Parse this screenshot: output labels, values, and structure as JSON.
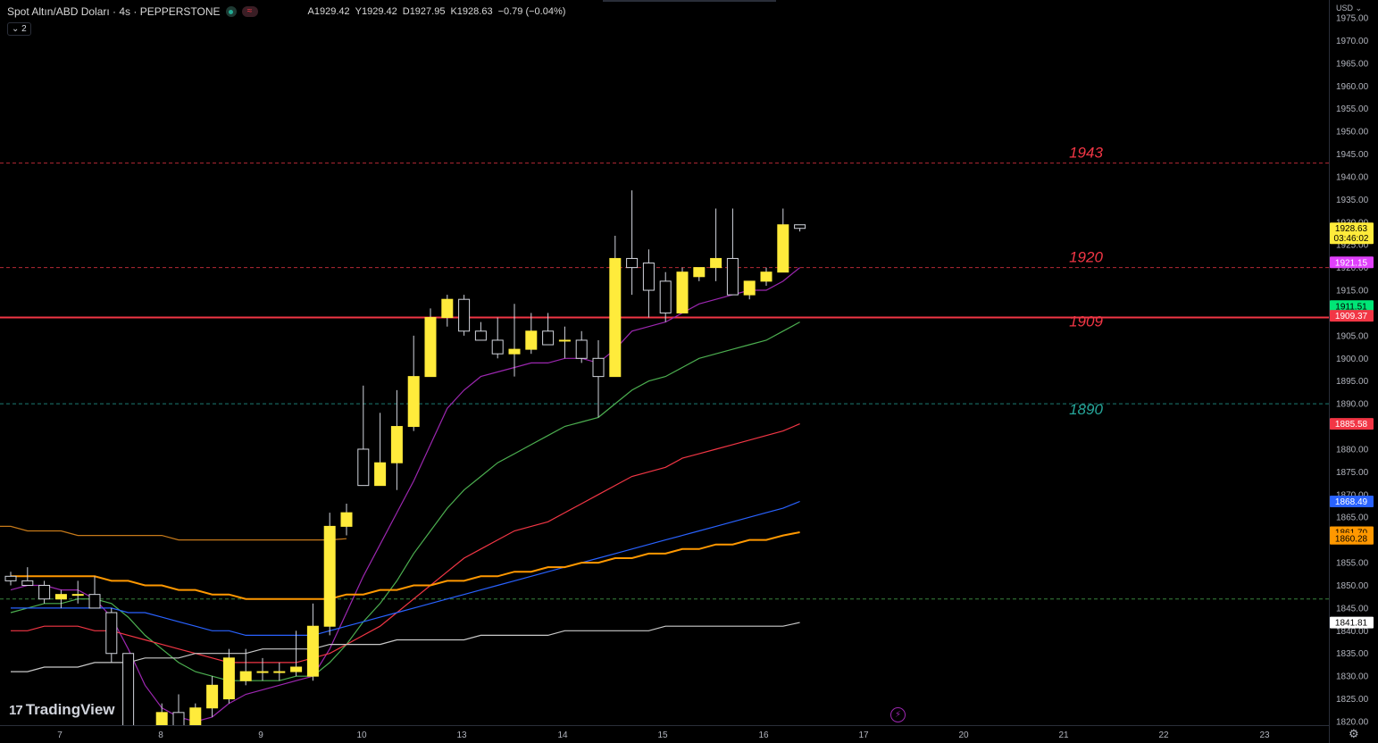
{
  "header": {
    "symbol": "Spot Altın/ABD Doları · 4s · PEPPERSTONE",
    "open": "A1929.42",
    "high": "Y1929.42",
    "low": "D1927.95",
    "close": "K1928.63",
    "change": "−0.79 (−0.04%)",
    "indicator_badge": "⌄ 2",
    "currency": "USD ⌄"
  },
  "branding": {
    "logo_mark": "17",
    "logo_text": "TradingView"
  },
  "colors": {
    "up": "#ffeb3b",
    "down": "#000000",
    "wick": "#d1d4dc",
    "grid": "#1b1e24",
    "background": "#000000"
  },
  "chart_data": {
    "type": "candlestick",
    "ylim": [
      1820,
      1975
    ],
    "y_ticks": [
      1820,
      1825,
      1830,
      1835,
      1840,
      1845,
      1850,
      1855,
      1860,
      1865,
      1870,
      1875,
      1880,
      1885,
      1890,
      1895,
      1900,
      1905,
      1910,
      1915,
      1920,
      1925,
      1930,
      1935,
      1940,
      1945,
      1950,
      1955,
      1960,
      1965,
      1970,
      1975
    ],
    "x_ticks": [
      "7",
      "8",
      "9",
      "10",
      "13",
      "14",
      "15",
      "16",
      "17",
      "20",
      "21",
      "22",
      "23"
    ],
    "candles": [
      {
        "o": 1852,
        "h": 1853,
        "l": 1850,
        "c": 1851
      },
      {
        "o": 1851,
        "h": 1854,
        "l": 1850,
        "c": 1850
      },
      {
        "o": 1850,
        "h": 1851,
        "l": 1846,
        "c": 1847
      },
      {
        "o": 1847,
        "h": 1849,
        "l": 1845,
        "c": 1848
      },
      {
        "o": 1848,
        "h": 1851,
        "l": 1846,
        "c": 1848
      },
      {
        "o": 1848,
        "h": 1852,
        "l": 1845,
        "c": 1845
      },
      {
        "o": 1844,
        "h": 1845,
        "l": 1833,
        "c": 1835
      },
      {
        "o": 1835,
        "h": 1835,
        "l": 1809,
        "c": 1811
      },
      {
        "o": 1811,
        "h": 1816,
        "l": 1808,
        "c": 1815
      },
      {
        "o": 1815,
        "h": 1824,
        "l": 1813,
        "c": 1822
      },
      {
        "o": 1822,
        "h": 1826,
        "l": 1816,
        "c": 1818
      },
      {
        "o": 1818,
        "h": 1824,
        "l": 1816,
        "c": 1823
      },
      {
        "o": 1823,
        "h": 1830,
        "l": 1821,
        "c": 1828
      },
      {
        "o": 1825,
        "h": 1836,
        "l": 1824,
        "c": 1834
      },
      {
        "o": 1829,
        "h": 1836,
        "l": 1828,
        "c": 1831
      },
      {
        "o": 1831,
        "h": 1834,
        "l": 1829,
        "c": 1831
      },
      {
        "o": 1831,
        "h": 1833,
        "l": 1829,
        "c": 1831
      },
      {
        "o": 1831,
        "h": 1840,
        "l": 1830,
        "c": 1832
      },
      {
        "o": 1830,
        "h": 1846,
        "l": 1829,
        "c": 1841
      },
      {
        "o": 1841,
        "h": 1866,
        "l": 1839,
        "c": 1863
      },
      {
        "o": 1863,
        "h": 1868,
        "l": 1861,
        "c": 1866
      },
      {
        "o": 1880,
        "h": 1894,
        "l": 1872,
        "c": 1872
      },
      {
        "o": 1872,
        "h": 1888,
        "l": 1872,
        "c": 1877
      },
      {
        "o": 1877,
        "h": 1893,
        "l": 1871,
        "c": 1885
      },
      {
        "o": 1885,
        "h": 1905,
        "l": 1884,
        "c": 1896
      },
      {
        "o": 1896,
        "h": 1911,
        "l": 1896,
        "c": 1909
      },
      {
        "o": 1909,
        "h": 1914,
        "l": 1907,
        "c": 1913
      },
      {
        "o": 1913,
        "h": 1914,
        "l": 1905,
        "c": 1906
      },
      {
        "o": 1906,
        "h": 1908,
        "l": 1904,
        "c": 1904
      },
      {
        "o": 1904,
        "h": 1909,
        "l": 1900,
        "c": 1901
      },
      {
        "o": 1901,
        "h": 1912,
        "l": 1896,
        "c": 1902
      },
      {
        "o": 1902,
        "h": 1910,
        "l": 1901,
        "c": 1906
      },
      {
        "o": 1906,
        "h": 1910,
        "l": 1903,
        "c": 1903
      },
      {
        "o": 1904,
        "h": 1907,
        "l": 1900,
        "c": 1904
      },
      {
        "o": 1904,
        "h": 1906,
        "l": 1899,
        "c": 1900
      },
      {
        "o": 1900,
        "h": 1904,
        "l": 1887,
        "c": 1896
      },
      {
        "o": 1896,
        "h": 1927,
        "l": 1896,
        "c": 1922
      },
      {
        "o": 1922,
        "h": 1937,
        "l": 1914,
        "c": 1920
      },
      {
        "o": 1921,
        "h": 1924,
        "l": 1909,
        "c": 1915
      },
      {
        "o": 1917,
        "h": 1919,
        "l": 1908,
        "c": 1910
      },
      {
        "o": 1910,
        "h": 1920,
        "l": 1910,
        "c": 1919
      },
      {
        "o": 1918,
        "h": 1920,
        "l": 1917,
        "c": 1920
      },
      {
        "o": 1920,
        "h": 1933,
        "l": 1917,
        "c": 1922
      },
      {
        "o": 1922,
        "h": 1933,
        "l": 1914,
        "c": 1914
      },
      {
        "o": 1914,
        "h": 1917,
        "l": 1913,
        "c": 1917
      },
      {
        "o": 1917,
        "h": 1920,
        "l": 1916,
        "c": 1919
      },
      {
        "o": 1919,
        "h": 1933,
        "l": 1919,
        "c": 1929.42
      },
      {
        "o": 1929.42,
        "h": 1929.42,
        "l": 1927.95,
        "c": 1928.63
      }
    ],
    "horizontal_levels": [
      {
        "value": 1943,
        "label": "1943",
        "color": "#f23645",
        "style": "dashed"
      },
      {
        "value": 1920,
        "label": "1920",
        "color": "#f23645",
        "style": "dashed"
      },
      {
        "value": 1909,
        "label": "1909",
        "color": "#f23645",
        "style": "solid"
      },
      {
        "value": 1890,
        "label": "1890",
        "color": "#26a69a",
        "style": "dashed"
      },
      {
        "value": 1847,
        "label": "",
        "color": "#4caf50",
        "style": "dashed"
      }
    ],
    "moving_averages": [
      {
        "color": "#9c27b0",
        "start_index": 0,
        "values": [
          1849,
          1850,
          1850,
          1849,
          1849,
          1847,
          1843,
          1836,
          1828,
          1823,
          1821,
          1820,
          1821,
          1824,
          1826,
          1827,
          1828,
          1829,
          1830,
          1836,
          1844,
          1852,
          1859,
          1866,
          1873,
          1881,
          1889,
          1893,
          1896,
          1897,
          1898,
          1899,
          1899,
          1900,
          1900,
          1899,
          1902,
          1906,
          1907,
          1908,
          1910,
          1912,
          1913,
          1914,
          1915,
          1915,
          1917,
          1920
        ]
      },
      {
        "color": "#4caf50",
        "start_index": 0,
        "values": [
          1844,
          1845,
          1846,
          1846,
          1847,
          1847,
          1846,
          1843,
          1839,
          1836,
          1833,
          1831,
          1830,
          1829,
          1829,
          1829,
          1829,
          1830,
          1830,
          1833,
          1837,
          1842,
          1846,
          1851,
          1857,
          1862,
          1867,
          1871,
          1874,
          1877,
          1879,
          1881,
          1883,
          1885,
          1886,
          1887,
          1890,
          1893,
          1895,
          1896,
          1898,
          1900,
          1901,
          1902,
          1903,
          1904,
          1906,
          1908
        ]
      },
      {
        "color": "#f23645",
        "start_index": 0,
        "values": [
          1840,
          1840,
          1841,
          1841,
          1841,
          1840,
          1840,
          1839,
          1838,
          1837,
          1836,
          1835,
          1834,
          1833,
          1833,
          1833,
          1833,
          1833,
          1834,
          1835,
          1837,
          1839,
          1841,
          1844,
          1847,
          1850,
          1853,
          1856,
          1858,
          1860,
          1862,
          1863,
          1864,
          1866,
          1868,
          1870,
          1872,
          1874,
          1875,
          1876,
          1878,
          1879,
          1880,
          1881,
          1882,
          1883,
          1884,
          1885.58
        ]
      },
      {
        "color": "#2962ff",
        "start_index": 0,
        "values": [
          1845,
          1845,
          1845,
          1845,
          1845,
          1845,
          1845,
          1844,
          1844,
          1843,
          1842,
          1841,
          1840,
          1840,
          1839,
          1839,
          1839,
          1839,
          1839,
          1840,
          1841,
          1842,
          1843,
          1844,
          1845,
          1846,
          1847,
          1848,
          1849,
          1850,
          1851,
          1852,
          1853,
          1854,
          1855,
          1856,
          1857,
          1858,
          1859,
          1860,
          1861,
          1862,
          1863,
          1864,
          1865,
          1866,
          1867,
          1868.49
        ]
      },
      {
        "color": "#ff9800",
        "start_index": 0,
        "values": [
          1852,
          1852,
          1852,
          1852,
          1852,
          1852,
          1851,
          1851,
          1850,
          1850,
          1849,
          1849,
          1848,
          1848,
          1847,
          1847,
          1847,
          1847,
          1847,
          1847,
          1848,
          1848,
          1849,
          1849,
          1850,
          1850,
          1851,
          1851,
          1852,
          1852,
          1853,
          1853,
          1854,
          1854,
          1855,
          1855,
          1856,
          1856,
          1857,
          1857,
          1858,
          1858,
          1859,
          1859,
          1860,
          1860,
          1861,
          1861.7
        ]
      },
      {
        "color": "#c77a1a",
        "start_index": -27,
        "values": [
          1876,
          1876,
          1875,
          1875,
          1874,
          1874,
          1873,
          1873,
          1872,
          1872,
          1871,
          1871,
          1870,
          1870,
          1869,
          1869,
          1868,
          1868,
          1867,
          1867,
          1866,
          1866,
          1865,
          1865,
          1864,
          1864,
          1863,
          1863,
          1862,
          1862,
          1862,
          1861,
          1861,
          1861,
          1861,
          1861,
          1861,
          1860,
          1860,
          1860,
          1860,
          1860,
          1860,
          1860,
          1860,
          1860,
          1860,
          1860.28
        ]
      },
      {
        "color": "#c9c9c9",
        "start_index": 0,
        "values": [
          1831,
          1831,
          1832,
          1832,
          1832,
          1833,
          1833,
          1833,
          1834,
          1834,
          1834,
          1835,
          1835,
          1835,
          1835,
          1836,
          1836,
          1836,
          1836,
          1837,
          1837,
          1837,
          1837,
          1838,
          1838,
          1838,
          1838,
          1838,
          1839,
          1839,
          1839,
          1839,
          1839,
          1840,
          1840,
          1840,
          1840,
          1840,
          1840,
          1841,
          1841,
          1841,
          1841,
          1841,
          1841,
          1841,
          1841,
          1841.81
        ]
      }
    ],
    "price_labels": [
      {
        "value": 1928.63,
        "text": "1928.63",
        "sub": "03:46:02",
        "bg": "#ffeb3b",
        "fg": "#000000"
      },
      {
        "value": 1921.15,
        "text": "1921.15",
        "bg": "#e040fb",
        "fg": "#ffffff"
      },
      {
        "value": 1911.51,
        "text": "1911.51",
        "bg": "#00e676",
        "fg": "#000000"
      },
      {
        "value": 1909.37,
        "text": "1909.37",
        "bg": "#f23645",
        "fg": "#ffffff"
      },
      {
        "value": 1885.58,
        "text": "1885.58",
        "bg": "#f23645",
        "fg": "#ffffff"
      },
      {
        "value": 1868.49,
        "text": "1868.49",
        "bg": "#2962ff",
        "fg": "#ffffff"
      },
      {
        "value": 1861.7,
        "text": "1861.70",
        "bg": "#ff9800",
        "fg": "#000000"
      },
      {
        "value": 1860.28,
        "text": "1860.28",
        "bg": "#ff9800",
        "fg": "#000000"
      },
      {
        "value": 1841.81,
        "text": "1841.81",
        "bg": "#ffffff",
        "fg": "#000000"
      }
    ]
  }
}
